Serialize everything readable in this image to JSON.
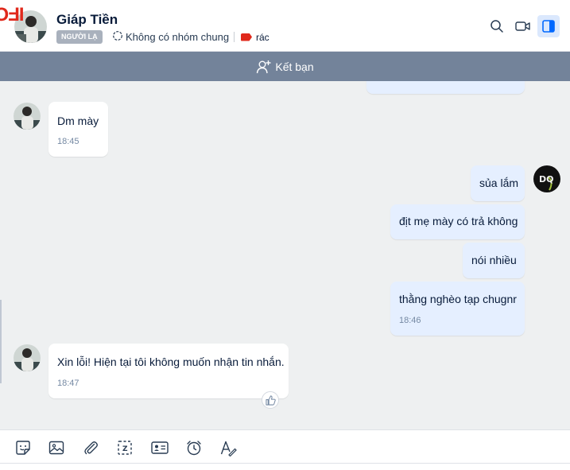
{
  "header": {
    "watermark": "IFO",
    "contact_name": "Giáp Tiền",
    "badge": "NGƯỜI LẠ",
    "common_groups": "Không có nhóm chung",
    "tag": "rác",
    "tag_color": "#e0281b"
  },
  "friend_bar": {
    "label": "Kết bạn",
    "background": "#73839a"
  },
  "messages": [
    {
      "direction": "in",
      "text": "Dm mày",
      "time": "18:45"
    },
    {
      "direction": "out",
      "text": "sủa lắm"
    },
    {
      "direction": "out",
      "text": "địt mẹ mày có trả không"
    },
    {
      "direction": "out",
      "text": "nói nhiều"
    },
    {
      "direction": "out",
      "text": "thằng nghèo tạp chugnr",
      "time": "18:46"
    },
    {
      "direction": "in",
      "text": "Xin lỗi! Hiện tại tôi không muốn nhận tin nhắn.",
      "time": "18:47"
    }
  ],
  "self_avatar_initials": "DQ",
  "toolbar": {
    "icons": [
      "sticker-icon",
      "image-icon",
      "attachment-icon",
      "screenshot-icon",
      "contact-card-icon",
      "reminder-icon",
      "text-format-icon"
    ]
  },
  "colors": {
    "incoming_bubble": "#ffffff",
    "outgoing_bubble": "#e5efff",
    "chat_background": "#eef0f1",
    "accent": "#0068ff"
  }
}
